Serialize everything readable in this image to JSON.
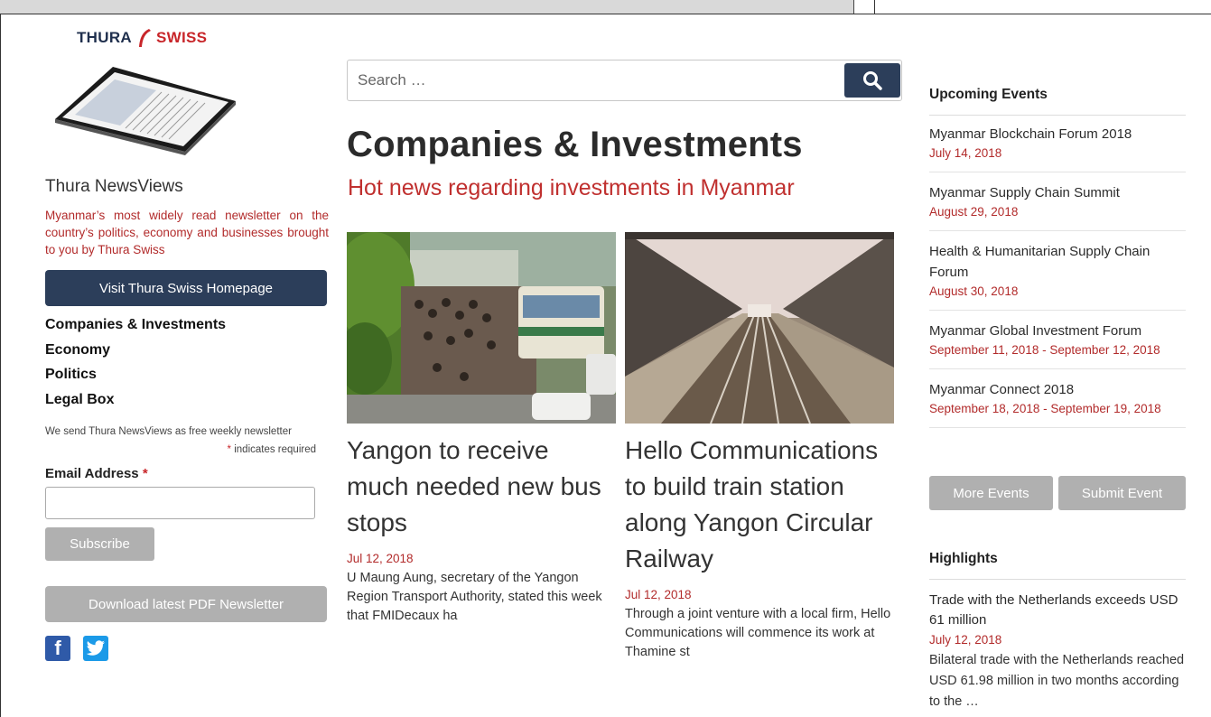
{
  "brand": {
    "left": "THURA",
    "right": "SWISS",
    "color_dark": "#1f2f4d",
    "color_red": "#c8262a"
  },
  "sidebar": {
    "newsletter_title": "Thura NewsViews",
    "newsletter_desc": "Myanmar’s most widely read newsletter on the country’s politics, economy and businesses brought to you by Thura Swiss",
    "visit_button": "Visit Thura Swiss Homepage",
    "nav": [
      "Companies & Investments",
      "Economy",
      "Politics",
      "Legal Box"
    ],
    "signup_text": "We send Thura NewsViews as free weekly newsletter",
    "required_star": "*",
    "required_text": "indicates required",
    "email_label": "Email Address",
    "email_value": "",
    "subscribe_button": "Subscribe",
    "pdf_button": "Download latest PDF Newsletter",
    "social": [
      "facebook-icon",
      "twitter-icon"
    ]
  },
  "search": {
    "placeholder": "Search …"
  },
  "page": {
    "title": "Companies & Investments",
    "subtitle": "Hot news regarding investments in Myanmar"
  },
  "articles": [
    {
      "title": "Yangon to receive much needed new bus stops",
      "date": "Jul 12, 2018",
      "excerpt": "U Maung Aung, secretary of the Yangon Region Transport Authority, stated this week that FMIDecaux ha"
    },
    {
      "title": "Hello Communications to build train station along Yangon Circular Railway",
      "date": "Jul 12, 2018",
      "excerpt": "Through a joint venture with a local firm, Hello Communications will commence its work at Thamine st"
    }
  ],
  "events": {
    "heading": "Upcoming Events",
    "items": [
      {
        "name": "Myanmar Blockchain Forum 2018",
        "date": "July 14, 2018"
      },
      {
        "name": "Myanmar Supply Chain Summit",
        "date": "August 29, 2018"
      },
      {
        "name": "Health & Humanitarian Supply Chain Forum",
        "date": "August 30, 2018"
      },
      {
        "name": "Myanmar Global Investment Forum",
        "date": "September 11, 2018 - September 12, 2018"
      },
      {
        "name": "Myanmar Connect 2018",
        "date": "September 18, 2018 - September 19, 2018"
      }
    ],
    "more_button": "More Events",
    "submit_button": "Submit Event"
  },
  "highlights": {
    "heading": "Highlights",
    "item": {
      "title": "Trade with the Netherlands exceeds USD 61 million",
      "date": "July 12, 2018",
      "excerpt": "Bilateral trade with the Netherlands reached USD 61.98 million in two months according to the …"
    }
  }
}
